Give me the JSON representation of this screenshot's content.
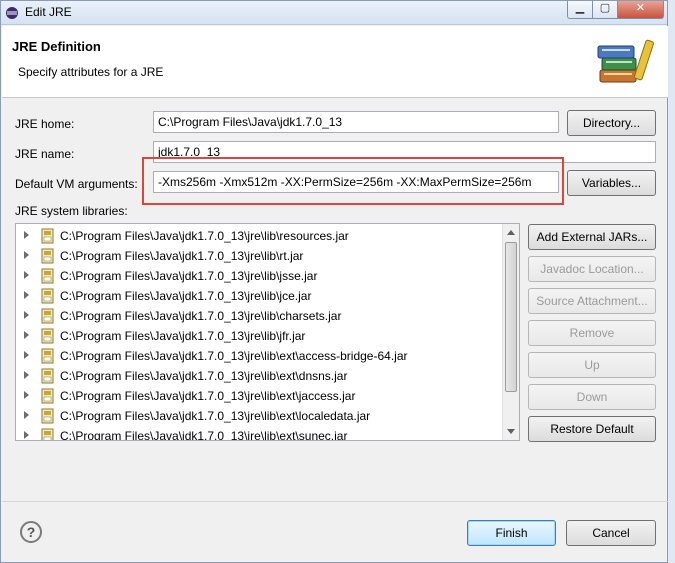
{
  "window": {
    "title": "Edit JRE",
    "controls": {
      "minimize": "▁",
      "maximize": "▢",
      "close": "✕"
    }
  },
  "header": {
    "title": "JRE Definition",
    "description": "Specify attributes for a JRE",
    "icon": "books-icon"
  },
  "form": {
    "jre_home_label": "JRE home:",
    "jre_home_value": "C:\\Program Files\\Java\\jdk1.7.0_13",
    "directory_button": "Directory...",
    "jre_name_label": "JRE name:",
    "jre_name_value": "jdk1.7.0_13",
    "vm_args_label": "Default VM arguments:",
    "vm_args_value": "-Xms256m -Xmx512m -XX:PermSize=256m -XX:MaxPermSize=256m",
    "variables_button": "Variables...",
    "libraries_label": "JRE system libraries:"
  },
  "libraries": [
    "C:\\Program Files\\Java\\jdk1.7.0_13\\jre\\lib\\resources.jar",
    "C:\\Program Files\\Java\\jdk1.7.0_13\\jre\\lib\\rt.jar",
    "C:\\Program Files\\Java\\jdk1.7.0_13\\jre\\lib\\jsse.jar",
    "C:\\Program Files\\Java\\jdk1.7.0_13\\jre\\lib\\jce.jar",
    "C:\\Program Files\\Java\\jdk1.7.0_13\\jre\\lib\\charsets.jar",
    "C:\\Program Files\\Java\\jdk1.7.0_13\\jre\\lib\\jfr.jar",
    "C:\\Program Files\\Java\\jdk1.7.0_13\\jre\\lib\\ext\\access-bridge-64.jar",
    "C:\\Program Files\\Java\\jdk1.7.0_13\\jre\\lib\\ext\\dnsns.jar",
    "C:\\Program Files\\Java\\jdk1.7.0_13\\jre\\lib\\ext\\jaccess.jar",
    "C:\\Program Files\\Java\\jdk1.7.0_13\\jre\\lib\\ext\\localedata.jar",
    "C:\\Program Files\\Java\\jdk1.7.0_13\\jre\\lib\\ext\\sunec.jar"
  ],
  "side_buttons": {
    "add_external_jars": "Add External JARs...",
    "javadoc_location": "Javadoc Location...",
    "source_attachment": "Source Attachment...",
    "remove": "Remove",
    "up": "Up",
    "down": "Down",
    "restore_default": "Restore Default"
  },
  "footer": {
    "help": "?",
    "finish": "Finish",
    "cancel": "Cancel"
  },
  "colors": {
    "highlight_box": "#d9463e",
    "default_button": "#3c7fb1"
  }
}
